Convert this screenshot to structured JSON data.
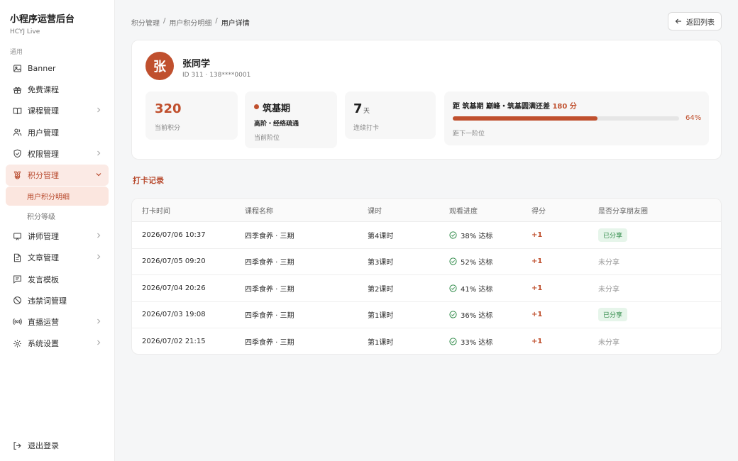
{
  "brand": {
    "title": "小程序运营后台",
    "subtitle": "HCYJ Live"
  },
  "sidebar": {
    "section_label": "通用",
    "items": [
      {
        "label": "Banner",
        "icon": "image-icon",
        "chevron": false
      },
      {
        "label": "免费课程",
        "icon": "gift-icon",
        "chevron": false
      },
      {
        "label": "课程管理",
        "icon": "book-icon",
        "chevron": true
      },
      {
        "label": "用户管理",
        "icon": "users-icon",
        "chevron": false
      },
      {
        "label": "权限管理",
        "icon": "shield-icon",
        "chevron": true
      },
      {
        "label": "积分管理",
        "icon": "award-icon",
        "chevron": true,
        "active": true
      },
      {
        "label": "讲师管理",
        "icon": "presentation-icon",
        "chevron": true
      },
      {
        "label": "文章管理",
        "icon": "document-icon",
        "chevron": true
      },
      {
        "label": "发言模板",
        "icon": "message-icon",
        "chevron": false
      },
      {
        "label": "违禁词管理",
        "icon": "ban-icon",
        "chevron": false
      },
      {
        "label": "直播运营",
        "icon": "broadcast-icon",
        "chevron": true
      },
      {
        "label": "系统设置",
        "icon": "gear-icon",
        "chevron": true
      }
    ],
    "sub_items": [
      {
        "label": "用户积分明细",
        "active": true
      },
      {
        "label": "积分等级",
        "active": false
      }
    ],
    "logout_label": "退出登录"
  },
  "breadcrumb": [
    "积分管理",
    "用户积分明细",
    "用户详情"
  ],
  "breadcrumb_sep": "/",
  "back_button": "返回列表",
  "user": {
    "avatar_char": "张",
    "name": "张同学",
    "meta": "ID 311 · 138****0001"
  },
  "stats": {
    "points": {
      "value": "320",
      "label": "当前积分"
    },
    "stage": {
      "name": "筑基期",
      "sub": "高阶・经络疏通",
      "label": "当前阶位"
    },
    "streak": {
      "value": "7",
      "unit": "天",
      "label": "连续打卡"
    },
    "next": {
      "prefix": "距 筑基期  巅峰・筑基圆满还差 ",
      "points": "180 分",
      "percent_text": "64%",
      "progress": 0.64,
      "label": "距下一阶位"
    }
  },
  "section_title": "打卡记录",
  "table": {
    "headers": [
      "打卡时间",
      "课程名称",
      "课时",
      "观看进度",
      "得分",
      "是否分享朋友圈"
    ],
    "rows": [
      {
        "time": "2026/07/06 10:37",
        "course": "四季食养 · 三期",
        "lesson": "第4课时",
        "progress": "38% 达标",
        "score": "+1",
        "shared": "已分享",
        "is_shared": true
      },
      {
        "time": "2026/07/05 09:20",
        "course": "四季食养 · 三期",
        "lesson": "第3课时",
        "progress": "52% 达标",
        "score": "+1",
        "shared": "未分享",
        "is_shared": false
      },
      {
        "time": "2026/07/04 20:26",
        "course": "四季食养 · 三期",
        "lesson": "第2课时",
        "progress": "41% 达标",
        "score": "+1",
        "shared": "未分享",
        "is_shared": false
      },
      {
        "time": "2026/07/03 19:08",
        "course": "四季食养 · 三期",
        "lesson": "第1课时",
        "progress": "36% 达标",
        "score": "+1",
        "shared": "已分享",
        "is_shared": true
      },
      {
        "time": "2026/07/02 21:15",
        "course": "四季食养 · 三期",
        "lesson": "第1课时",
        "progress": "33% 达标",
        "score": "+1",
        "shared": "未分享",
        "is_shared": false
      }
    ]
  },
  "colors": {
    "accent": "#c0502e",
    "accent_bg": "#fbeae5",
    "success": "#2f8a48",
    "success_bg": "#e6f5ea"
  }
}
